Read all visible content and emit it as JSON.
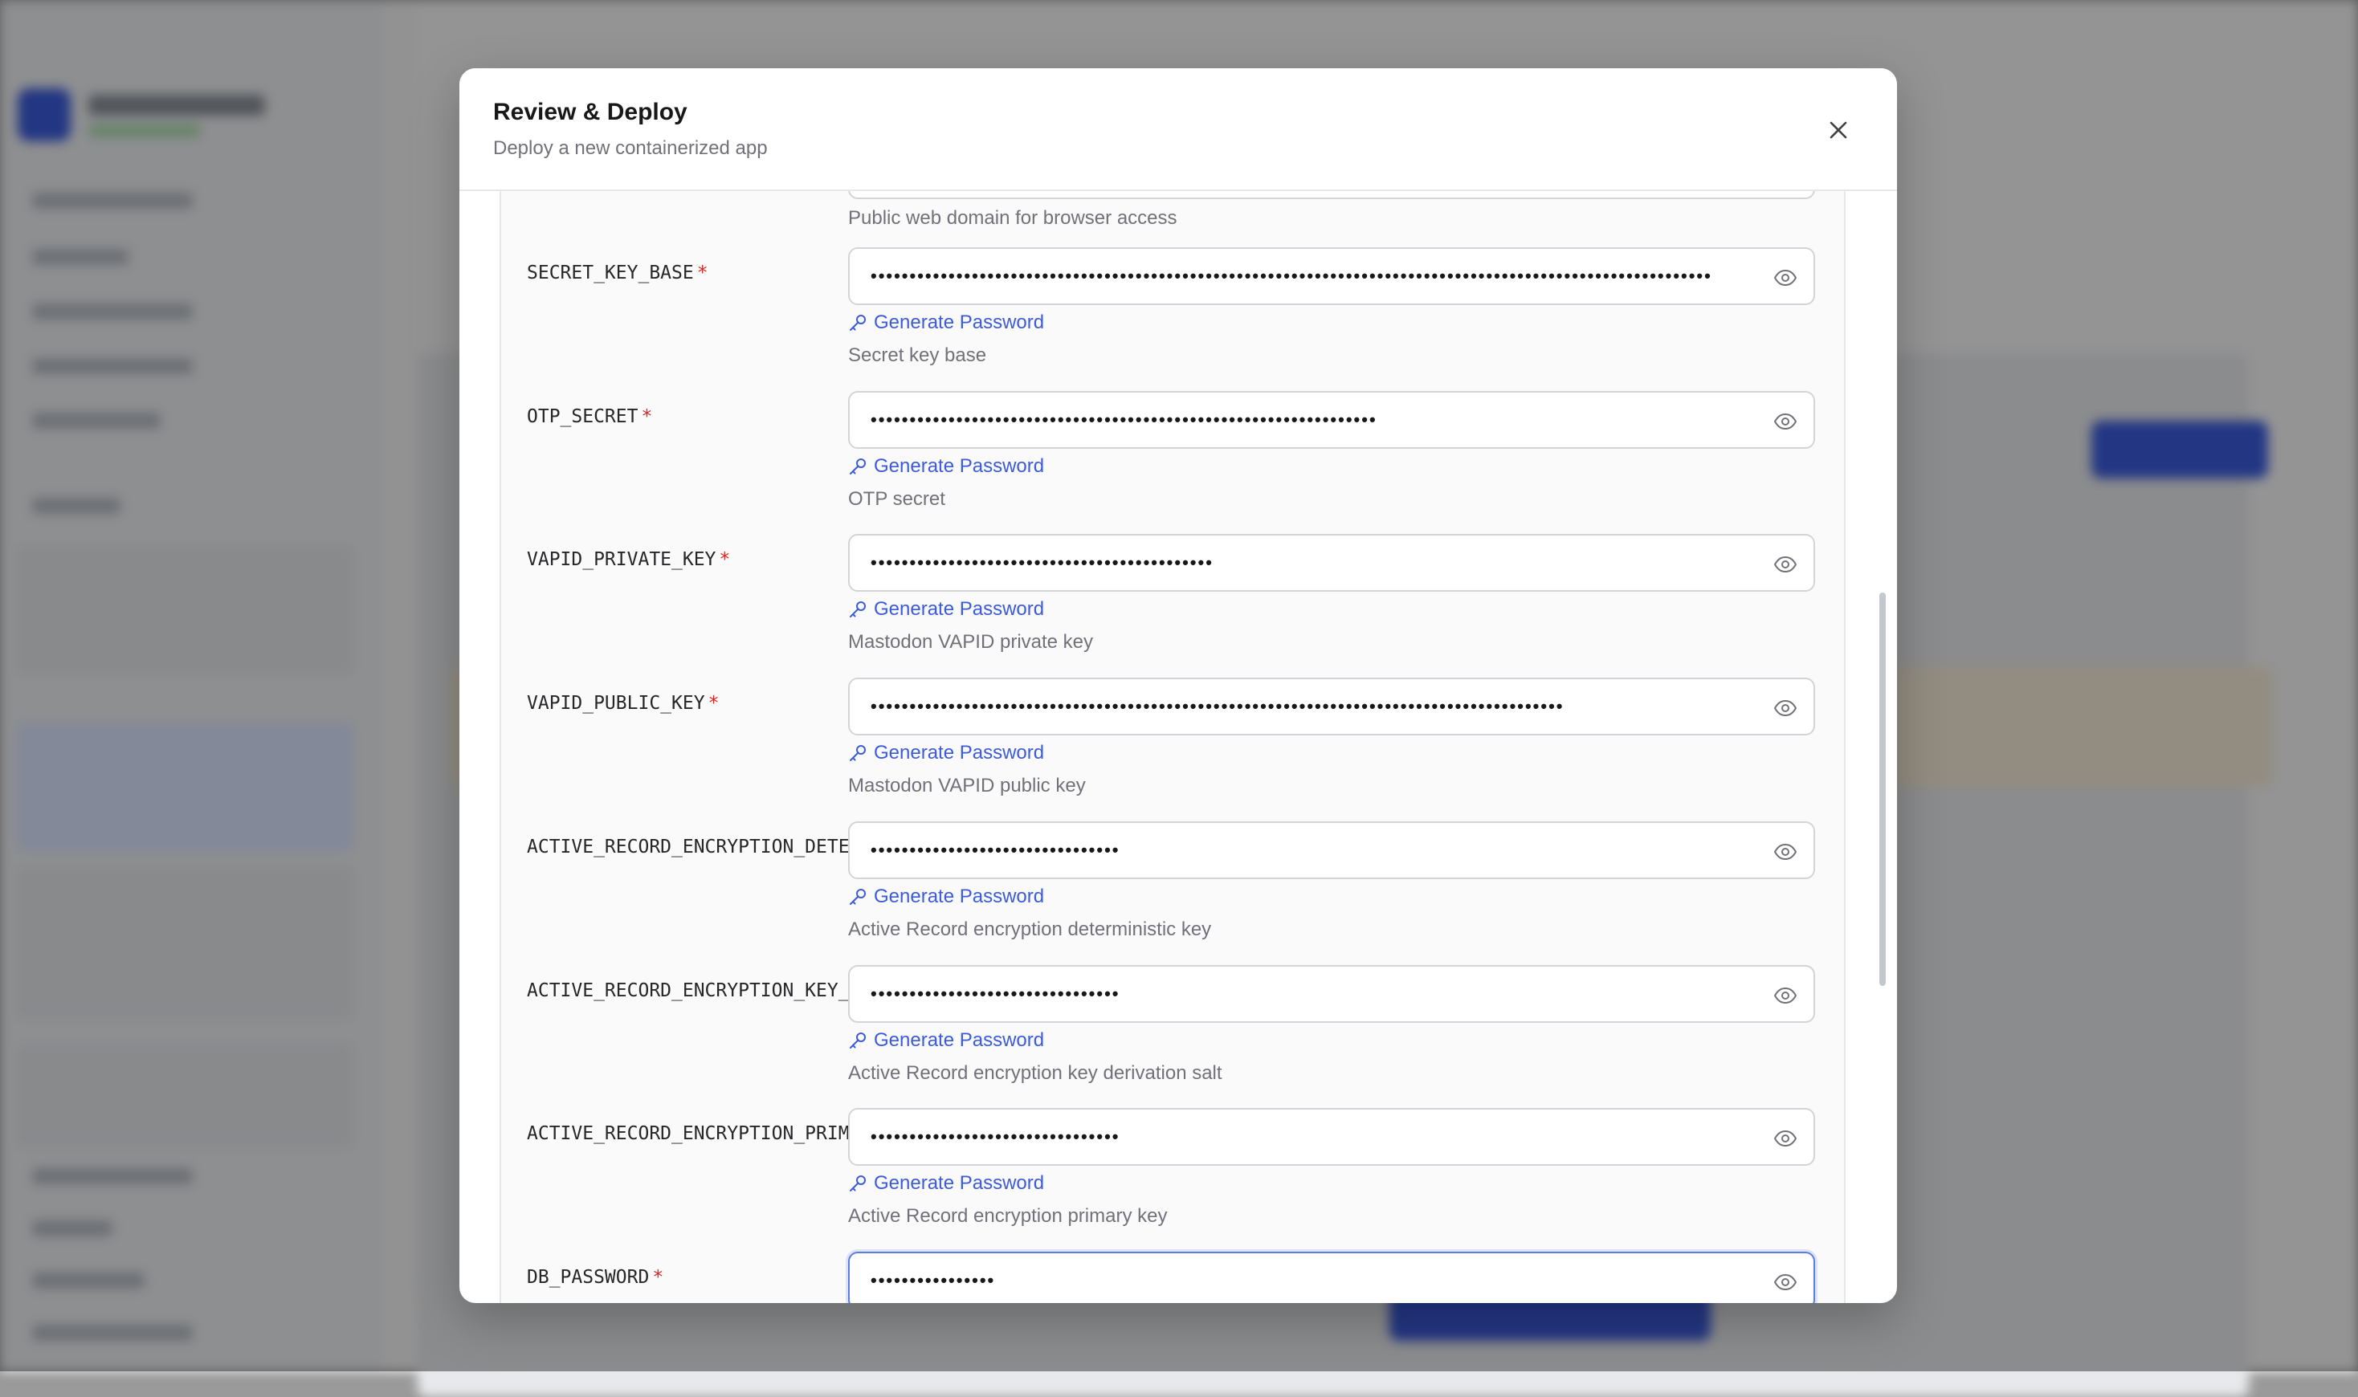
{
  "modal": {
    "title": "Review & Deploy",
    "subtitle": "Deploy a new containerized app"
  },
  "top_field": {
    "help": "Public web domain for browser access"
  },
  "generate_label": "Generate Password",
  "fields": [
    {
      "label": "SECRET_KEY_BASE",
      "required": "*",
      "masked": "••••••••••••••••••••••••••••••••••••••••••••••••••••••••••••••••••••••••••••••••••••••••••••••••••••••••••••",
      "help": "Secret key base"
    },
    {
      "label": "OTP_SECRET",
      "required": "*",
      "masked": "•••••••••••••••••••••••••••••••••••••••••••••••••••••••••••••••••",
      "help": "OTP secret"
    },
    {
      "label": "VAPID_PRIVATE_KEY",
      "required": "*",
      "masked": "••••••••••••••••••••••••••••••••••••••••••••",
      "help": "Mastodon VAPID private key"
    },
    {
      "label": "VAPID_PUBLIC_KEY",
      "required": "*",
      "masked": "•••••••••••••••••••••••••••••••••••••••••••••••••••••••••••••••••••••••••••••••••••••••••",
      "help": "Mastodon VAPID public key"
    },
    {
      "label": "ACTIVE_RECORD_ENCRYPTION_DETERMINISTIC_KEY",
      "required": "",
      "masked": "••••••••••••••••••••••••••••••••",
      "help": "Active Record encryption deterministic key"
    },
    {
      "label": "ACTIVE_RECORD_ENCRYPTION_KEY_DERIVATION_SALT",
      "required": "",
      "masked": "••••••••••••••••••••••••••••••••",
      "help": "Active Record encryption key derivation salt"
    },
    {
      "label": "ACTIVE_RECORD_ENCRYPTION_PRIMARY_KEY",
      "required": "",
      "masked": "••••••••••••••••••••••••••••••••",
      "help": "Active Record encryption primary key"
    },
    {
      "label": "DB_PASSWORD",
      "required": "*",
      "masked": "••••••••••••••••",
      "help": ""
    }
  ],
  "colors": {
    "accent": "#3b5bdb",
    "required": "#dc2626",
    "focus_border": "#5b7be6"
  }
}
